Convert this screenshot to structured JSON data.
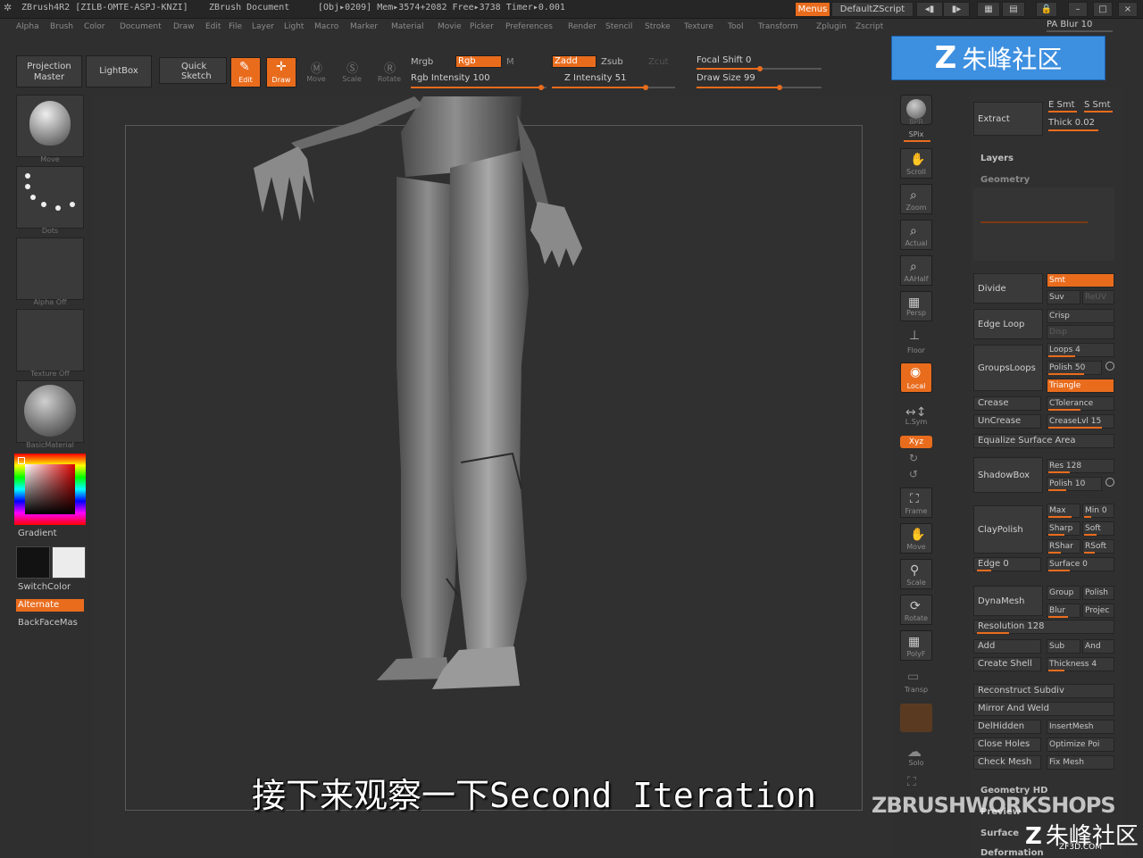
{
  "titlebar": {
    "app": "ZBrush4R2 [ZILB-OMTE-ASPJ-KNZI]",
    "doc": "ZBrush Document",
    "stats": "[Obj▸0209] Mem▸3574+2082 Free▸3738 Timer▸0.001",
    "menus_btn": "Menus",
    "script_btn": "DefaultZScript"
  },
  "menubar": [
    "Alpha",
    "Brush",
    "Color",
    "Document",
    "Draw",
    "Edit",
    "File",
    "Layer",
    "Light",
    "Macro",
    "Marker",
    "Material",
    "Movie",
    "Picker",
    "Preferences",
    "Render",
    "Stencil",
    "Stroke",
    "Texture",
    "Tool",
    "Transform",
    "Zplugin",
    "Zscript"
  ],
  "shelf": {
    "projection_master": [
      "Projection",
      "Master"
    ],
    "lightbox": "LightBox",
    "quick_sketch": [
      "Quick",
      "Sketch"
    ],
    "edit": "Edit",
    "draw": "Draw",
    "move": "Move",
    "scale": "Scale",
    "rotate": "Rotate",
    "mrgb": "Mrgb",
    "rgb": "Rgb",
    "m": "M",
    "rgb_intensity": "Rgb Intensity 100",
    "zadd": "Zadd",
    "zsub": "Zsub",
    "zcut": "Zcut",
    "z_intensity": "Z Intensity 51",
    "focal_shift": "Focal Shift 0",
    "draw_size": "Draw Size 99"
  },
  "left": {
    "tiles": [
      "Move",
      "Dots",
      "Alpha Off",
      "Texture Off",
      "BasicMaterial"
    ],
    "gradient": "Gradient",
    "switchcolor": "SwitchColor",
    "alternate": "Alternate",
    "backfacemask": "BackFaceMas"
  },
  "right_shelf": [
    "BPR",
    "SPix",
    "Scroll",
    "Zoom",
    "Actual",
    "AAHalf",
    "Persp",
    "Floor",
    "Local",
    "L.Sym",
    "Xyz",
    "Frame",
    "Move",
    "Scale",
    "Rotate",
    "PolyF",
    "Transp",
    "Solo"
  ],
  "tool": {
    "pa_blur": "PA Blur 10",
    "extract": "Extract",
    "e_smt": "E Smt",
    "s_smt": "S Smt",
    "thick": "Thick 0.02",
    "layers": "Layers",
    "geometry": "Geometry",
    "divide": "Divide",
    "smt": "Smt",
    "suv": "Suv",
    "reuv": "ReUV",
    "edge_loop": "Edge Loop",
    "crisp": "Crisp",
    "disp": "Disp",
    "groups_loops": "GroupsLoops",
    "loops": "Loops 4",
    "polish": "Polish 50",
    "triangle": "Triangle",
    "crease": "Crease",
    "ctolerance": "CTolerance",
    "uncrease": "UnCrease",
    "creaselvl": "CreaseLvl 15",
    "equalize": "Equalize Surface Area",
    "shadowbox": "ShadowBox",
    "res": "Res 128",
    "polish10": "Polish 10",
    "claypolish": "ClayPolish",
    "max": "Max",
    "min": "Min 0",
    "sharp": "Sharp",
    "soft": "Soft",
    "rsharp": "RShar",
    "rsoft": "RSoft",
    "edge": "Edge 0",
    "surface": "Surface 0",
    "dynamesh": "DynaMesh",
    "group": "Group",
    "dpolish": "Polish",
    "blur": "Blur",
    "project": "Projec",
    "resolution": "Resolution 128",
    "add": "Add",
    "sub": "Sub",
    "and": "And",
    "create_shell": "Create Shell",
    "thickness": "Thickness 4",
    "reconstruct": "Reconstruct Subdiv",
    "mirror_weld": "Mirror And Weld",
    "delhidden": "DelHidden",
    "insertmesh": "InsertMesh",
    "close_holes": "Close Holes",
    "optimize": "Optimize Poi",
    "check_mesh": "Check Mesh",
    "fix_mesh": "Fix Mesh",
    "geometry_hd": "Geometry HD",
    "preview": "Preview",
    "surface_sec": "Surface",
    "deformation": "Deformation"
  },
  "subtitle": "接下来观察一下Second Iteration",
  "watermark": {
    "top_logo": "朱峰社区",
    "bottom_text": "ZBRUSHWORKSHOPS",
    "bottom_logo": "朱峰社区",
    "url": "ZF3D.COM"
  },
  "colors": {
    "accent": "#e96c1d",
    "bg": "#2f2f2f",
    "logo_blue": "#3d8fe0"
  }
}
